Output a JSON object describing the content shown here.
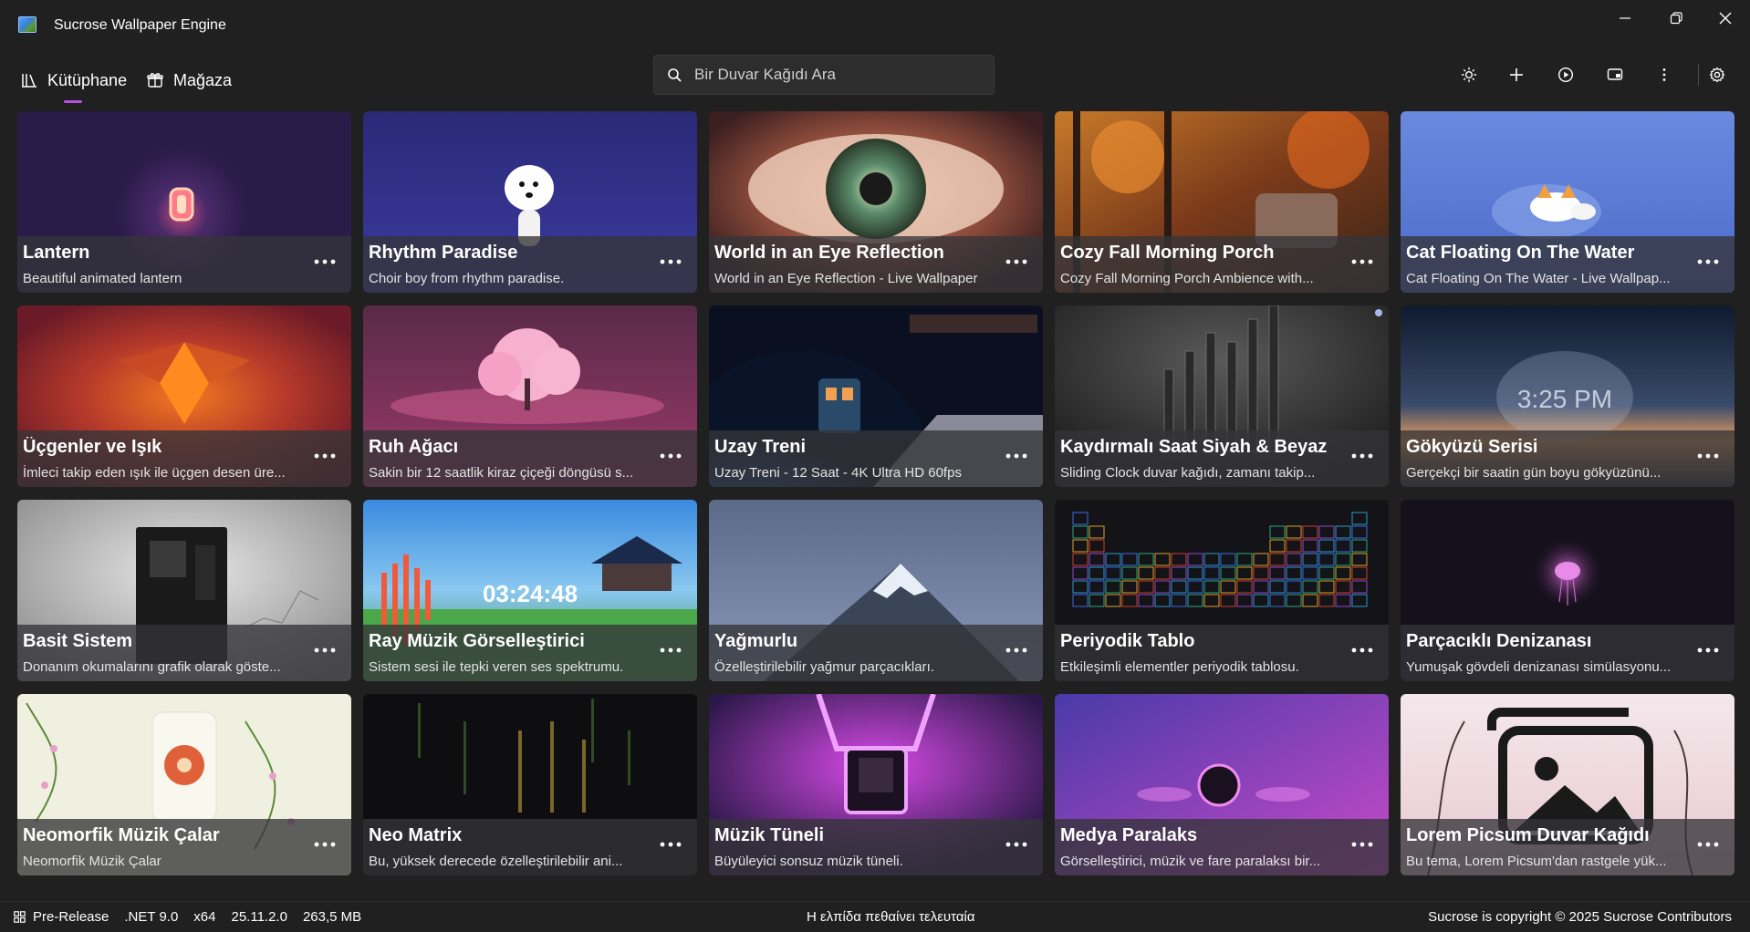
{
  "window": {
    "title": "Sucrose Wallpaper Engine",
    "icons": [
      "minimize-icon",
      "restore-icon",
      "close-icon"
    ]
  },
  "nav": {
    "tabs": [
      {
        "label": "Kütüphane",
        "icon": "library-icon",
        "active": true
      },
      {
        "label": "Mağaza",
        "icon": "store-icon",
        "active": false
      }
    ],
    "accent": "#b84fe0"
  },
  "search": {
    "placeholder": "Bir Duvar Kağıdı Ara",
    "value": ""
  },
  "toolbar": {
    "icons": [
      "brightness-icon",
      "add-icon",
      "play-icon",
      "display-icon",
      "more-vertical-icon",
      "settings-icon"
    ]
  },
  "wallpapers": [
    {
      "title": "Lantern",
      "desc": "Beautiful animated lantern"
    },
    {
      "title": "Rhythm Paradise",
      "desc": "Choir boy from rhythm paradise."
    },
    {
      "title": "World in an Eye Reflection",
      "desc": "World in an Eye Reflection - Live Wallpaper"
    },
    {
      "title": "Cozy Fall Morning Porch",
      "desc": "Cozy Fall Morning Porch Ambience with..."
    },
    {
      "title": "Cat Floating On The Water",
      "desc": "Cat Floating On The Water - Live Wallpap..."
    },
    {
      "title": "Üçgenler ve Işık",
      "desc": "İmleci takip eden ışık ile üçgen desen üre..."
    },
    {
      "title": "Ruh Ağacı",
      "desc": "Sakin bir 12 saatlik kiraz çiçeği döngüsü s..."
    },
    {
      "title": "Uzay Treni",
      "desc": "Uzay Treni - 12 Saat - 4K Ultra HD 60fps"
    },
    {
      "title": "Kaydırmalı Saat Siyah & Beyaz",
      "desc": "Sliding Clock duvar kağıdı, zamanı takip..."
    },
    {
      "title": "Gökyüzü Serisi",
      "desc": "Gerçekçi bir saatin gün boyu gökyüzünü..."
    },
    {
      "title": "Basit Sistem",
      "desc": "Donanım okumalarını grafik olarak göste..."
    },
    {
      "title": "Ray Müzik Görselleştirici",
      "desc": "Sistem sesi ile tepki veren ses spektrumu."
    },
    {
      "title": "Yağmurlu",
      "desc": "Özelleştirilebilir yağmur parçacıkları."
    },
    {
      "title": "Periyodik Tablo",
      "desc": "Etkileşimli elementler periyodik tablosu."
    },
    {
      "title": "Parçacıklı Denizanası",
      "desc": "Yumuşak gövdeli denizanası simülasyonu..."
    },
    {
      "title": "Neomorfik Müzik Çalar",
      "desc": "Neomorfik Müzik Çalar"
    },
    {
      "title": "Neo Matrix",
      "desc": "Bu, yüksek derecede özelleştirilebilir ani..."
    },
    {
      "title": "Müzik Tüneli",
      "desc": "Büyüleyici sonsuz müzik tüneli."
    },
    {
      "title": "Medya Paralaks",
      "desc": "Görselleştirici, müzik ve fare paralaksı bir..."
    },
    {
      "title": "Lorem Picsum Duvar Kağıdı",
      "desc": "Bu tema, Lorem Picsum'dan rastgele yük..."
    }
  ],
  "thumb_art": [
    {
      "text": ""
    },
    {
      "text": ""
    },
    {
      "text": ""
    },
    {
      "text": ""
    },
    {
      "text": ""
    },
    {
      "text": ""
    },
    {
      "text": ""
    },
    {
      "text": ""
    },
    {
      "text": ""
    },
    {
      "text": "3:25 PM"
    },
    {
      "text": ""
    },
    {
      "text": "03:24:48"
    },
    {
      "text": ""
    },
    {
      "text": ""
    },
    {
      "text": ""
    },
    {
      "text": ""
    },
    {
      "text": ""
    },
    {
      "text": ""
    },
    {
      "text": ""
    },
    {
      "text": ""
    }
  ],
  "status": {
    "release": "Pre-Release",
    "framework": ".NET 9.0",
    "arch": "x64",
    "version": "25.11.2.0",
    "memory": "263,5 MB",
    "quote": "Η ελπίδα πεθαίνει τελευταία",
    "copyright": "Sucrose is copyright © 2025 Sucrose Contributors"
  }
}
